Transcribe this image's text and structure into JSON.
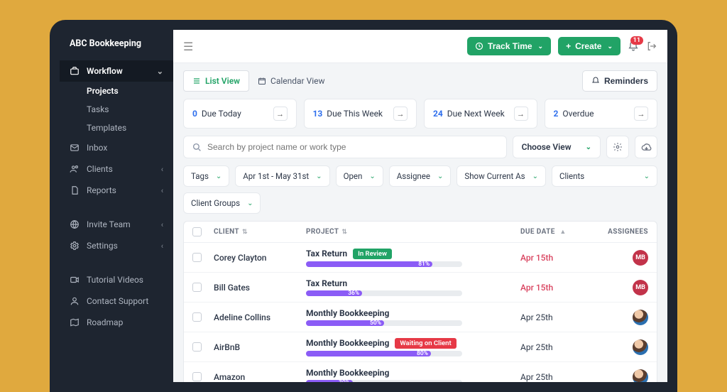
{
  "brand": "ABC Bookkeeping",
  "sidebar": {
    "workflow": {
      "label": "Workflow",
      "projects": "Projects",
      "tasks": "Tasks",
      "templates": "Templates"
    },
    "inbox": "Inbox",
    "clients": "Clients",
    "reports": "Reports",
    "invite": "Invite Team",
    "settings": "Settings",
    "tutorials": "Tutorial Videos",
    "support": "Contact Support",
    "roadmap": "Roadmap"
  },
  "topbar": {
    "track_time": "Track Time",
    "create": "Create",
    "notif_count": "11"
  },
  "viewbar": {
    "list": "List View",
    "calendar": "Calendar View",
    "reminders": "Reminders"
  },
  "stats": {
    "a": {
      "n": "0",
      "l": "Due Today"
    },
    "b": {
      "n": "13",
      "l": "Due This Week"
    },
    "c": {
      "n": "24",
      "l": "Due Next Week"
    },
    "d": {
      "n": "2",
      "l": "Overdue"
    }
  },
  "search": {
    "placeholder": "Search by project name or work type",
    "choose_view": "Choose View"
  },
  "filters": {
    "tags": "Tags",
    "daterange": "Apr 1st - May 31st",
    "open": "Open",
    "assignee": "Assignee",
    "show_current": "Show Current As",
    "clients": "Clients",
    "client_groups": "Client Groups"
  },
  "columns": {
    "client": "CLIENT",
    "project": "PROJECT",
    "due": "DUE DATE",
    "assignees": "ASSIGNEES"
  },
  "rows": [
    {
      "client": "Corey Clayton",
      "project": "Tax Return",
      "tag": "In Review",
      "tag_class": "green",
      "pct": 81,
      "due": "Apr 15th",
      "overdue": true,
      "avatar": "MB",
      "avclass": "av-mb"
    },
    {
      "client": "Bill Gates",
      "project": "Tax Return",
      "tag": "",
      "tag_class": "",
      "pct": 36,
      "due": "Apr 15th",
      "overdue": true,
      "avatar": "MB",
      "avclass": "av-mb"
    },
    {
      "client": "Adeline Collins",
      "project": "Monthly Bookkeeping",
      "tag": "",
      "tag_class": "",
      "pct": 50,
      "due": "Apr 25th",
      "overdue": false,
      "avatar": "",
      "avclass": "av-photo"
    },
    {
      "client": "AirBnB",
      "project": "Monthly Bookkeeping",
      "tag": "Waiting on Client",
      "tag_class": "red",
      "pct": 80,
      "due": "Apr 25th",
      "overdue": false,
      "avatar": "",
      "avclass": "av-photo"
    },
    {
      "client": "Amazon",
      "project": "Monthly Bookkeeping",
      "tag": "",
      "tag_class": "",
      "pct": 30,
      "due": "Apr 25th",
      "overdue": false,
      "avatar": "",
      "avclass": "av-photo"
    }
  ]
}
